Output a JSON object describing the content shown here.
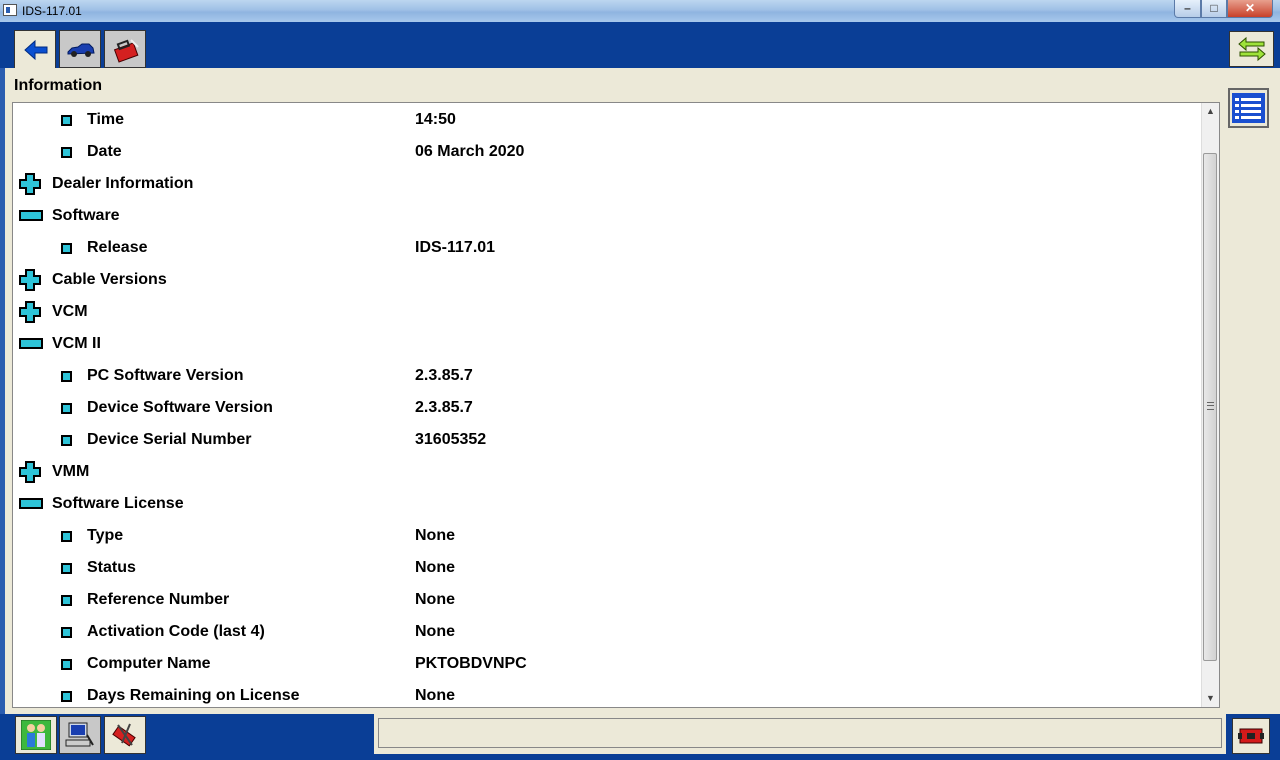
{
  "window": {
    "title": "IDS-117.01",
    "controls": {
      "minimize": "–",
      "maximize": "□",
      "close": "✕"
    }
  },
  "toolbar": {
    "tabs": [
      {
        "name": "back-tab",
        "icon": "back-arrow-icon",
        "active": true
      },
      {
        "name": "vehicle-tab",
        "icon": "car-icon",
        "active": false
      },
      {
        "name": "toolbox-tab",
        "icon": "toolbox-icon",
        "active": false
      }
    ],
    "right_button_icon": "swap-arrows-icon"
  },
  "panel": {
    "title": "Information",
    "rows": [
      {
        "kind": "item",
        "label": "Time",
        "value": "14:50"
      },
      {
        "kind": "item",
        "label": "Date",
        "value": "06 March 2020"
      },
      {
        "kind": "collapsed",
        "label": "Dealer Information",
        "value": ""
      },
      {
        "kind": "expanded",
        "label": "Software",
        "value": ""
      },
      {
        "kind": "item",
        "label": "Release",
        "value": "IDS-117.01"
      },
      {
        "kind": "collapsed",
        "label": "Cable Versions",
        "value": ""
      },
      {
        "kind": "collapsed",
        "label": "VCM",
        "value": ""
      },
      {
        "kind": "expanded",
        "label": "VCM II",
        "value": ""
      },
      {
        "kind": "item",
        "label": "PC Software Version",
        "value": "2.3.85.7"
      },
      {
        "kind": "item",
        "label": "Device Software Version",
        "value": "2.3.85.7"
      },
      {
        "kind": "item",
        "label": "Device Serial Number",
        "value": "31605352"
      },
      {
        "kind": "collapsed",
        "label": "VMM",
        "value": ""
      },
      {
        "kind": "expanded",
        "label": "Software License",
        "value": ""
      },
      {
        "kind": "item",
        "label": "Type",
        "value": "None"
      },
      {
        "kind": "item",
        "label": "Status",
        "value": "None"
      },
      {
        "kind": "item",
        "label": "Reference Number",
        "value": "None"
      },
      {
        "kind": "item",
        "label": "Activation Code (last 4)",
        "value": "None"
      },
      {
        "kind": "item",
        "label": "Computer Name",
        "value": "PKTOBDVNPC"
      },
      {
        "kind": "item",
        "label": "Days Remaining on License",
        "value": "None"
      }
    ]
  },
  "sidebar": {
    "list_button_icon": "list-icon"
  },
  "bottombar": {
    "buttons": [
      {
        "name": "people-button",
        "icon": "people-icon"
      },
      {
        "name": "computer-button",
        "icon": "computer-icon"
      },
      {
        "name": "tools-button",
        "icon": "tools-icon"
      }
    ],
    "status_text": "",
    "stop_icon": "stop-icon"
  },
  "colors": {
    "frame_blue": "#0a3e96",
    "panel_bg": "#ece9d8",
    "tree_cyan": "#2ec4d8"
  }
}
